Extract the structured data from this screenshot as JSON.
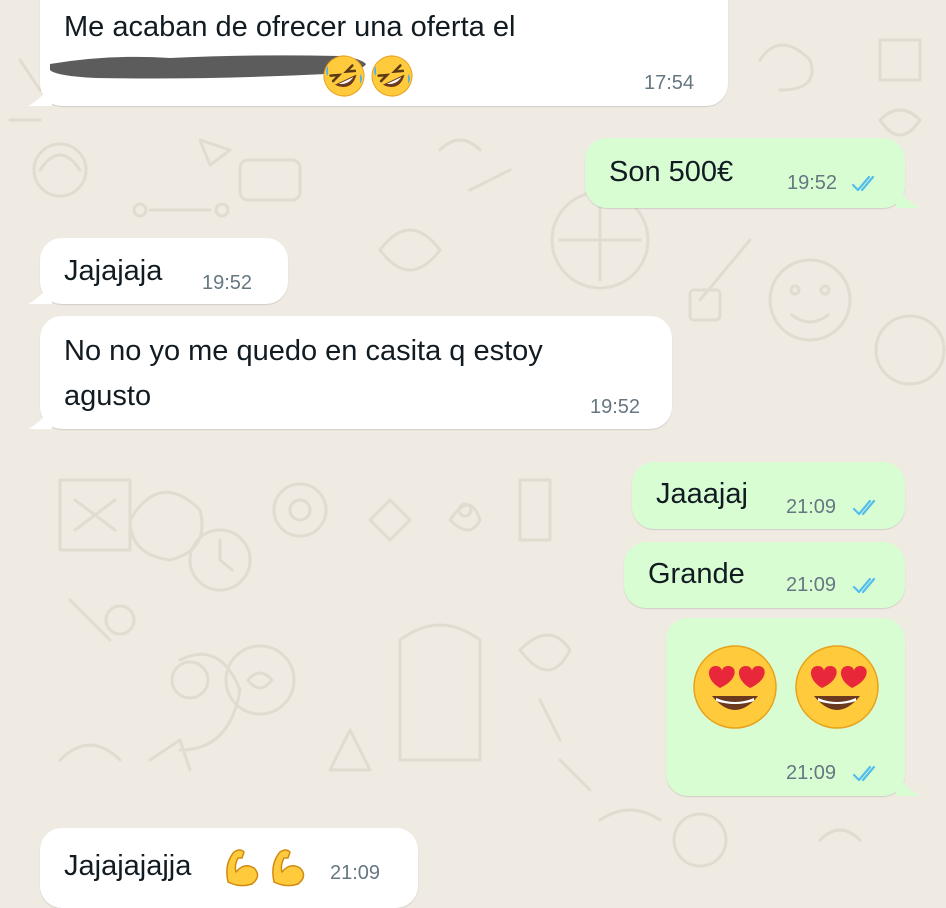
{
  "colors": {
    "background": "#efeae2",
    "incoming_bubble": "#ffffff",
    "outgoing_bubble": "#d9fdd3",
    "read_ticks": "#53bdeb",
    "timestamp": "#667781"
  },
  "messages": [
    {
      "direction": "incoming",
      "text": "Me acaban de ofrecer una oferta el",
      "redacted": true,
      "emojis": [
        "rolling-on-floor-laughing",
        "rolling-on-floor-laughing"
      ],
      "time": "17:54"
    },
    {
      "direction": "outgoing",
      "text": "Son 500€",
      "time": "19:52",
      "status": "read"
    },
    {
      "direction": "incoming",
      "text": "Jajajaja",
      "time": "19:52"
    },
    {
      "direction": "incoming",
      "text_line1": "No no yo me quedo en casita q estoy",
      "text_line2": "agusto",
      "time": "19:52"
    },
    {
      "direction": "outgoing",
      "text": "Jaaajaj",
      "time": "21:09",
      "status": "read"
    },
    {
      "direction": "outgoing",
      "text": "Grande",
      "time": "21:09",
      "status": "read"
    },
    {
      "direction": "outgoing",
      "emojis": [
        "smiling-face-with-heart-eyes",
        "smiling-face-with-heart-eyes"
      ],
      "time": "21:09",
      "status": "read"
    },
    {
      "direction": "incoming",
      "text": "Jajajajajja",
      "emojis": [
        "flexed-biceps",
        "flexed-biceps"
      ],
      "time": "21:09"
    }
  ]
}
